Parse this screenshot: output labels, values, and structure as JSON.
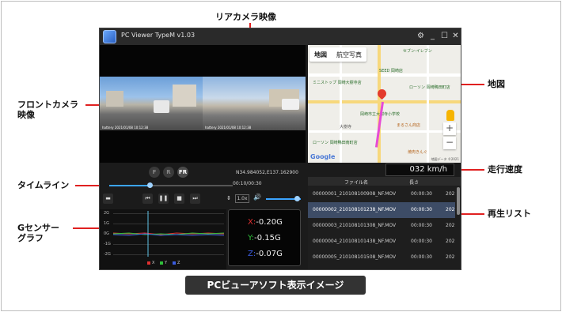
{
  "annotations": {
    "rear_camera": "リアカメラ映像",
    "front_camera_line1": "フロントカメラ",
    "front_camera_line2": "映像",
    "timeline": "タイムライン",
    "gsensor_line1": "Gセンサー",
    "gsensor_line2": "グラフ",
    "map": "地図",
    "speed": "走行速度",
    "playlist": "再生リスト",
    "accent_color": "#e02020"
  },
  "caption": "PCビューアソフト表示イメージ",
  "app": {
    "title": "PC Viewer TypeM v1.03",
    "icons": [
      "gear-icon",
      "minimize-icon",
      "maximize-icon",
      "close-icon"
    ]
  },
  "video": {
    "front_timestamp": "hattery 2021/01/08 10:12:38",
    "rear_timestamp": "hattery 2021/01/08 10:12:38"
  },
  "map": {
    "tabs": [
      "地図",
      "航空写真"
    ],
    "labels": [
      "セブン-イレブン",
      "SEED 岡崎店",
      "ミニストップ 岡崎大樹寺店",
      "ローソン 岡崎鴨田町店",
      "岡崎市立大樹寺小学校",
      "ローソン 岡崎鴨田南町店",
      "まるさん商店",
      "焼肉きんぐ",
      "大樹寺"
    ],
    "google": "Google",
    "credit": "地図データ ©2021"
  },
  "controls": {
    "camera_buttons": [
      "F",
      "R",
      "FR"
    ],
    "coordinates": "N34.984052,E137.162900",
    "time": "00:10/00:30",
    "playback_speed": "1.0x",
    "timeline_progress": 0.33,
    "volume": 0.85
  },
  "gsensor": {
    "axis_labels": [
      "2G",
      "1G",
      "0G",
      "-1G",
      "-2G"
    ],
    "legend": [
      "X",
      "Y",
      "Z"
    ],
    "colors": {
      "x": "#e03030",
      "y": "#2fbf3a",
      "z": "#3b5de0"
    },
    "values": {
      "x_label": "X:",
      "x": "-0.20G",
      "y_label": "Y:",
      "y": "-0.15G",
      "z_label": "Z:",
      "z": "-0.07G"
    }
  },
  "speed": "032 km/h",
  "playlist": {
    "headers": [
      "ファイル名",
      "長さ"
    ],
    "rows": [
      {
        "name": "00000001_210108100908_NF.MOV",
        "length": "00:00:30",
        "date": "202",
        "selected": false
      },
      {
        "name": "00000002_210108101238_NF.MOV",
        "length": "00:00:30",
        "date": "202",
        "selected": true
      },
      {
        "name": "00000003_210108101308_NF.MOV",
        "length": "00:00:30",
        "date": "202",
        "selected": false
      },
      {
        "name": "00000004_210108101438_NF.MOV",
        "length": "00:00:30",
        "date": "202",
        "selected": false
      },
      {
        "name": "00000005_210108101508_NF.MOV",
        "length": "00:00:30",
        "date": "202",
        "selected": false
      }
    ]
  }
}
